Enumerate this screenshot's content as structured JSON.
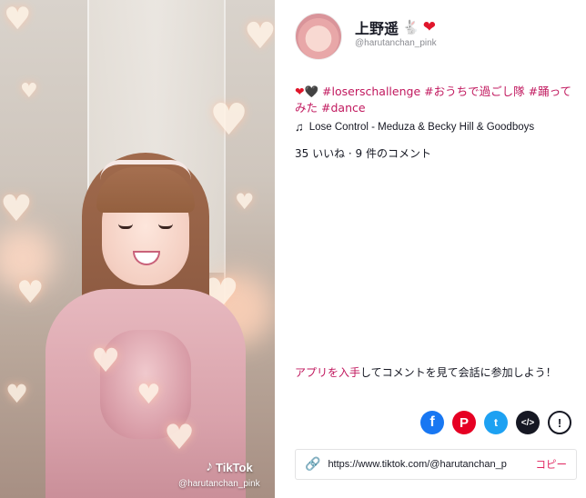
{
  "video": {
    "watermark_logo": "TikTok",
    "watermark_user": "@harutanchan_pink"
  },
  "author": {
    "nickname": "上野遥",
    "nickname_emoji": "🐇",
    "nickname_heart": "❤",
    "handle": "@harutanchan_pink"
  },
  "caption": {
    "emoji_red_heart": "❤",
    "emoji_black_heart": "🖤",
    "tags": [
      "#loserschallenge",
      "#おうちで過ごし隊",
      "#踊ってみた",
      "#dance"
    ]
  },
  "music": {
    "icon": "music-note-icon",
    "title": "Lose Control - Meduza & Becky Hill & Goodboys"
  },
  "stats": {
    "text": "35 いいね · 9 件のコメント"
  },
  "promo": {
    "link": "アプリを入手",
    "rest": "してコメントを見て会話に参加しよう！"
  },
  "share": {
    "facebook": "f",
    "pinterest": "P",
    "twitter": "t",
    "embed": "</>",
    "report": "!"
  },
  "copy": {
    "url": "https://www.tiktok.com/@harutanchan_p",
    "button": "コピー"
  },
  "colors": {
    "tag": "#c1185e",
    "copy": "#e0245e",
    "facebook": "#1877f2",
    "pinterest": "#e60023",
    "twitter": "#1da1f2"
  }
}
